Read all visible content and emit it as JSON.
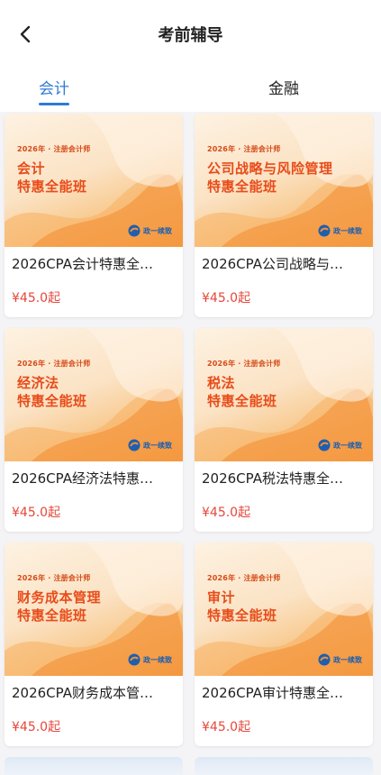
{
  "header": {
    "title": "考前辅导"
  },
  "tabs": [
    {
      "label": "会计",
      "active": true
    },
    {
      "label": "金融",
      "active": false
    }
  ],
  "colors": {
    "accent": "#2f7bd6",
    "price": "#e5473a",
    "banner_text": "#e84c1a"
  },
  "products": [
    {
      "kicker": "2026年 · 注册会计师",
      "course": "会计",
      "subtitle": "特惠全能班",
      "brand": "政一续致",
      "title": "2026CPA会计特惠全…",
      "price": "¥45.0起"
    },
    {
      "kicker": "2026年 · 注册会计师",
      "course": "公司战略与风险管理",
      "subtitle": "特惠全能班",
      "brand": "政一续致",
      "title": "2026CPA公司战略与…",
      "price": "¥45.0起"
    },
    {
      "kicker": "2026年 · 注册会计师",
      "course": "经济法",
      "subtitle": "特惠全能班",
      "brand": "政一续致",
      "title": "2026CPA经济法特惠…",
      "price": "¥45.0起"
    },
    {
      "kicker": "2026年 · 注册会计师",
      "course": "税法",
      "subtitle": "特惠全能班",
      "brand": "政一续致",
      "title": "2026CPA税法特惠全…",
      "price": "¥45.0起"
    },
    {
      "kicker": "2026年 · 注册会计师",
      "course": "财务成本管理",
      "subtitle": "特惠全能班",
      "brand": "政一续致",
      "title": "2026CPA财务成本管…",
      "price": "¥45.0起"
    },
    {
      "kicker": "2026年 · 注册会计师",
      "course": "审计",
      "subtitle": "特惠全能班",
      "brand": "政一续致",
      "title": "2026CPA审计特惠全…",
      "price": "¥45.0起"
    }
  ]
}
